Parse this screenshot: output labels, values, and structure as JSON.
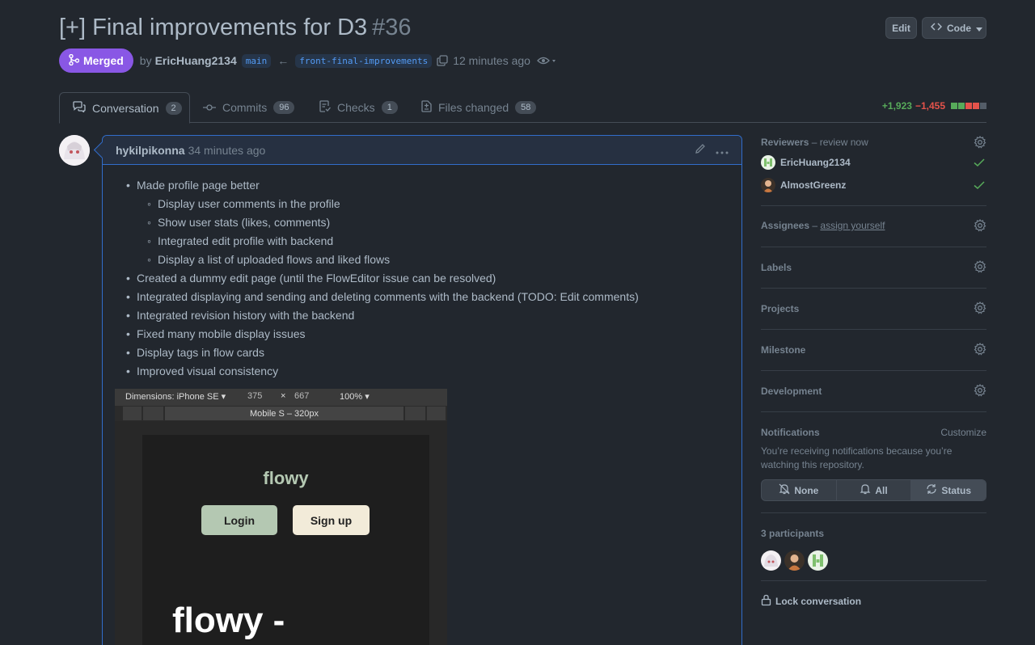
{
  "header": {
    "title": "[+] Final improvements for D3",
    "number": "#36",
    "edit_label": "Edit",
    "code_label": "Code"
  },
  "meta": {
    "status": "Merged",
    "by": "by",
    "author": "EricHuang2134",
    "base_branch": "main",
    "head_branch": "front-final-improvements",
    "time": "12 minutes ago"
  },
  "tabs": [
    {
      "label": "Conversation",
      "count": "2"
    },
    {
      "label": "Commits",
      "count": "96"
    },
    {
      "label": "Checks",
      "count": "1"
    },
    {
      "label": "Files changed",
      "count": "58"
    }
  ],
  "diffstat": {
    "additions": "+1,923",
    "deletions": "−1,455"
  },
  "comment": {
    "author": "hykilpikonna",
    "time": "34 minutes ago",
    "items": [
      {
        "text": "Made profile page better",
        "level": 1
      },
      {
        "text": "Display user comments in the profile",
        "level": 2
      },
      {
        "text": "Show user stats (likes, comments)",
        "level": 2
      },
      {
        "text": "Integrated edit profile with backend",
        "level": 2
      },
      {
        "text": "Display a list of uploaded flows and liked flows",
        "level": 2
      },
      {
        "text": "Created a dummy edit page (until the FlowEditor issue can be resolved)",
        "level": 1
      },
      {
        "text": "Integrated displaying and sending and deleting comments with the backend (TODO: Edit comments)",
        "level": 1
      },
      {
        "text": "Integrated revision history with the backend",
        "level": 1
      },
      {
        "text": "Fixed many mobile display issues",
        "level": 1
      },
      {
        "text": "Display tags in flow cards",
        "level": 1
      },
      {
        "text": "Improved visual consistency",
        "level": 1
      }
    ],
    "screenshot": {
      "dimensions": "Dimensions: iPhone SE ▾",
      "width": "375",
      "times": "×",
      "height": "667",
      "zoom": "100% ▾",
      "breakpoint": "Mobile S – 320px",
      "logo": "flowy",
      "login": "Login",
      "signup": "Sign up",
      "hero": "flowy -"
    }
  },
  "sidebar": {
    "reviewers_title": "Reviewers",
    "reviewers_note": "– review now",
    "reviewers": [
      {
        "name": "EricHuang2134"
      },
      {
        "name": "AlmostGreenz"
      }
    ],
    "assignees_title": "Assignees",
    "assignees_dash": "–",
    "assignees_link": "assign yourself",
    "labels_title": "Labels",
    "projects_title": "Projects",
    "milestone_title": "Milestone",
    "development_title": "Development",
    "notifications_title": "Notifications",
    "customize": "Customize",
    "notif_text": "You’re receiving notifications because you’re watching this repository.",
    "notif_none": "None",
    "notif_all": "All",
    "notif_status": "Status",
    "participants_title": "3 participants",
    "lock": "Lock conversation"
  },
  "colors": {
    "merged": "#8957e5",
    "additions": "#57ab5a",
    "deletions": "#e5534b",
    "link": "#539bf5"
  }
}
